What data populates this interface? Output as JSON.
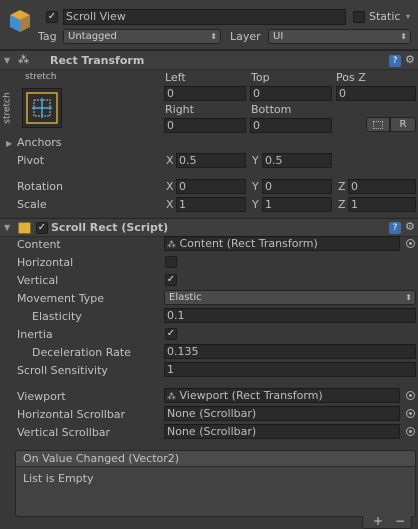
{
  "gameobject": {
    "active_check": "✓",
    "name": "Scroll View",
    "static_label": "Static",
    "tag_label": "Tag",
    "tag_value": "Untagged",
    "layer_label": "Layer",
    "layer_value": "UI"
  },
  "rect_transform": {
    "title": "Rect Transform",
    "anchor_top_label": "stretch",
    "anchor_side_label": "stretch",
    "col1_label": "Left",
    "col2_label": "Top",
    "col3_label": "Pos Z",
    "left": "0",
    "top": "0",
    "posz": "0",
    "col1b_label": "Right",
    "col2b_label": "Bottom",
    "right": "0",
    "bottom": "0",
    "raw_btn": "R",
    "anchors_label": "Anchors",
    "pivot_label": "Pivot",
    "pivot_x": "0.5",
    "pivot_y": "0.5",
    "rotation_label": "Rotation",
    "rot_x": "0",
    "rot_y": "0",
    "rot_z": "0",
    "scale_label": "Scale",
    "scale_x": "1",
    "scale_y": "1",
    "scale_z": "1",
    "axis_x": "X",
    "axis_y": "Y",
    "axis_z": "Z"
  },
  "scroll_rect": {
    "title": "Scroll Rect (Script)",
    "content_label": "Content",
    "content_value": "Content (Rect Transform)",
    "horizontal_label": "Horizontal",
    "horizontal_checked": false,
    "vertical_label": "Vertical",
    "vertical_check": "✓",
    "movement_label": "Movement Type",
    "movement_value": "Elastic",
    "elasticity_label": "Elasticity",
    "elasticity_value": "0.1",
    "inertia_label": "Inertia",
    "inertia_check": "✓",
    "decel_label": "Deceleration Rate",
    "decel_value": "0.135",
    "sensitivity_label": "Scroll Sensitivity",
    "sensitivity_value": "1",
    "viewport_label": "Viewport",
    "viewport_value": "Viewport (Rect Transform)",
    "hscroll_label": "Horizontal Scrollbar",
    "hscroll_value": "None (Scrollbar)",
    "vscroll_label": "Vertical Scrollbar",
    "vscroll_value": "None (Scrollbar)"
  },
  "event": {
    "title": "On Value Changed (Vector2)",
    "empty_text": "List is Empty",
    "add_btn": "+",
    "remove_btn": "−"
  },
  "colors": {
    "background": "#383838",
    "field": "#2a2a2a",
    "header": "#3e3e3e",
    "text": "#c2c2c2",
    "accent_blue": "#3d6fb0"
  }
}
